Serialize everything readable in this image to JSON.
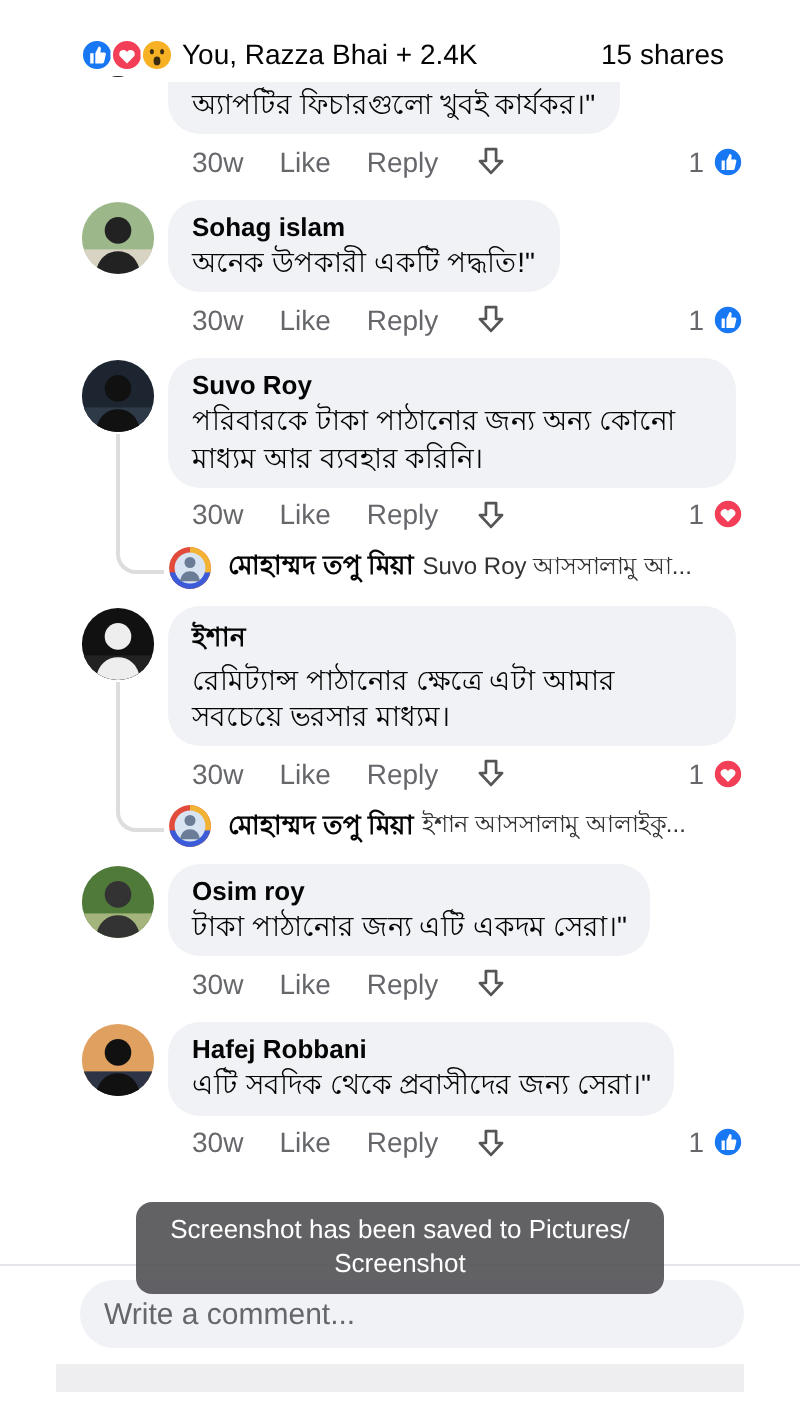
{
  "reactions_bar": {
    "reactions": [
      {
        "kind": "like"
      },
      {
        "kind": "love"
      },
      {
        "kind": "wow"
      }
    ],
    "summary": "You, Razza Bhai + 2.4K",
    "shares": "15 shares"
  },
  "comments": [
    {
      "kind": "partial",
      "text": "অ্যাপটির ফিচারগুলো খুবই কার্যকর।\"",
      "time": "30w",
      "like": "Like",
      "reply": "Reply",
      "reaction_count": "1",
      "reaction": {
        "kind": "like"
      }
    },
    {
      "kind": "full",
      "author": "Sohag islam",
      "text": "অনেক উপকারী একটি পদ্ধতি!\"",
      "time": "30w",
      "like": "Like",
      "reply": "Reply",
      "reaction_count": "1",
      "reaction": {
        "kind": "like"
      }
    },
    {
      "kind": "full",
      "author": "Suvo Roy",
      "text": "পরিবারকে টাকা পাঠানোর জন্য অন্য কোনো মাধ্যম আর ব্যবহার করিনি।",
      "time": "30w",
      "like": "Like",
      "reply": "Reply",
      "reaction_count": "1",
      "reaction": {
        "kind": "love"
      },
      "replies": [
        {
          "author": "মোহাম্মদ তপু মিয়া",
          "text": "Suvo Roy আসসালামু আ..."
        }
      ]
    },
    {
      "kind": "full",
      "author": "ইশান",
      "text": "রেমিট্যান্স পাঠানোর ক্ষেত্রে এটা আমার সবচেয়ে ভরসার মাধ্যম।",
      "time": "30w",
      "like": "Like",
      "reply": "Reply",
      "reaction_count": "1",
      "reaction": {
        "kind": "love"
      },
      "replies": [
        {
          "author": "মোহাম্মদ তপু মিয়া",
          "text": "ইশান আসসালামু আলাইকু..."
        }
      ]
    },
    {
      "kind": "full",
      "author": "Osim roy",
      "text": "টাকা পাঠানোর জন্য এটি একদম সেরা।\"",
      "time": "30w",
      "like": "Like",
      "reply": "Reply"
    },
    {
      "kind": "full",
      "author": "Hafej Robbani",
      "text": "এটি সবদিক থেকে প্রবাসীদের জন্য সেরা।\"",
      "time": "30w",
      "like": "Like",
      "reply": "Reply",
      "reaction_count": "1",
      "reaction": {
        "kind": "like"
      }
    }
  ],
  "composer": {
    "placeholder": "Write a comment..."
  },
  "toast": {
    "text": "Screenshot has been saved to  Pictures/ Screenshot"
  }
}
